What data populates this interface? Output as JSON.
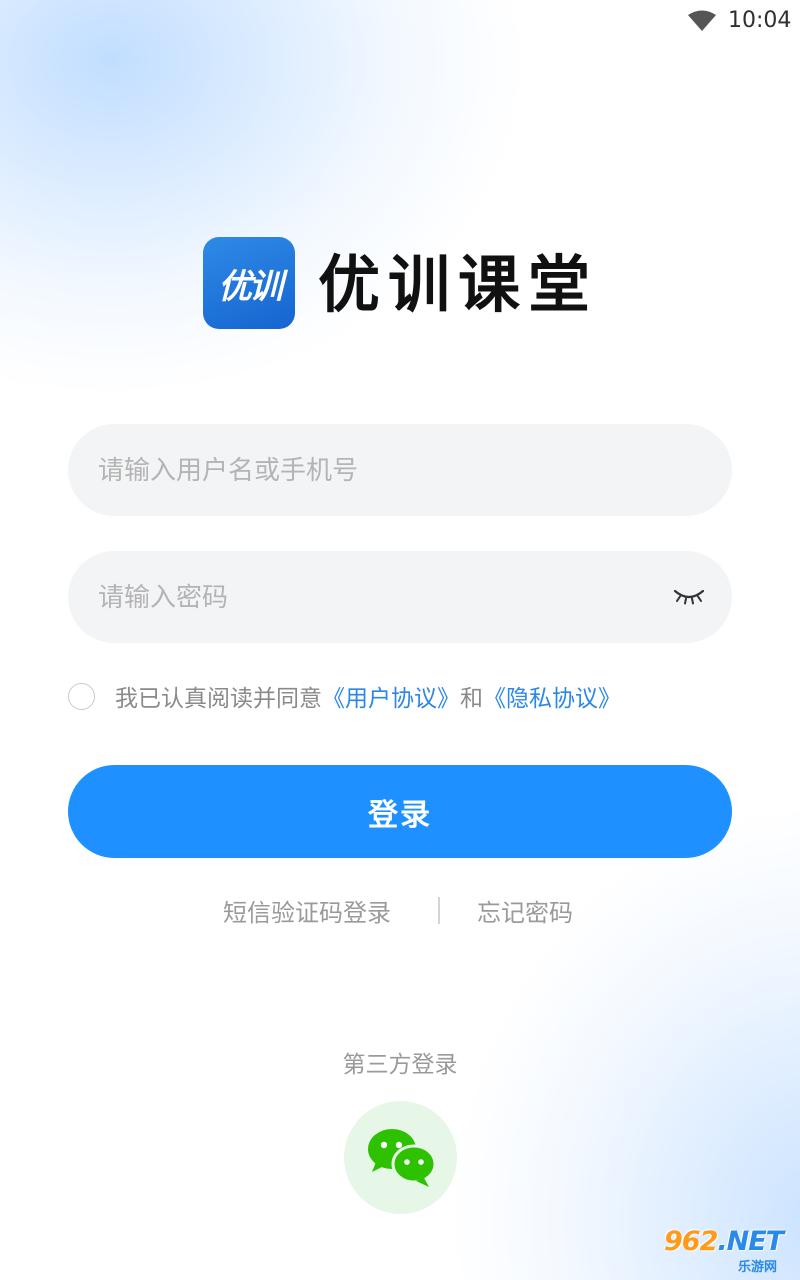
{
  "status_bar": {
    "time": "10:04",
    "wifi_icon": "wifi-icon"
  },
  "brand": {
    "logo_text": "优训",
    "name": "优训课堂",
    "logo_color": "#1e78e0"
  },
  "form": {
    "username_placeholder": "请输入用户名或手机号",
    "username_value": "",
    "password_placeholder": "请输入密码",
    "password_value": "",
    "password_toggle_icon": "eye-closed-icon"
  },
  "agreement": {
    "checked": false,
    "prefix": "我已认真阅读并同意",
    "user_agreement": "《用户协议》",
    "conjunction": "和",
    "privacy_policy": "《隐私协议》"
  },
  "actions": {
    "login_label": "登录",
    "sms_login_label": "短信验证码登录",
    "forgot_password_label": "忘记密码"
  },
  "third_party": {
    "title": "第三方登录",
    "wechat_icon": "wechat-icon"
  },
  "watermark": {
    "brand": "962",
    "suffix": ".NET",
    "subtitle": "乐游网"
  },
  "colors": {
    "primary": "#1e90ff",
    "link": "#2b87e8",
    "wechat_green": "#2dc100"
  }
}
